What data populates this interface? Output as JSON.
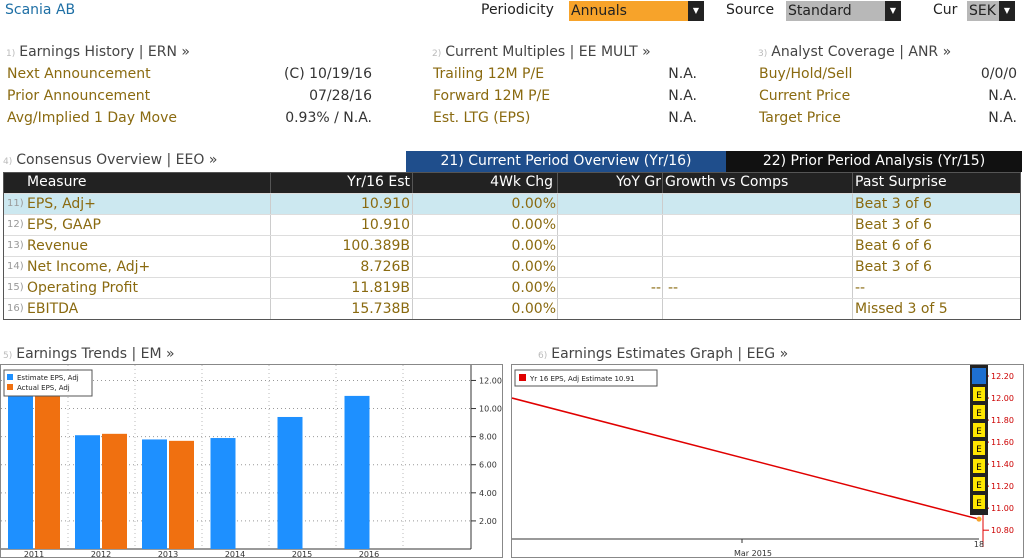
{
  "header": {
    "company": "Scania AB",
    "periodicity_label": "Periodicity",
    "periodicity_value": "Annuals",
    "source_label": "Source",
    "source_value": "Standard",
    "cur_label": "Cur",
    "cur_value": "SEK"
  },
  "sections": {
    "earnings_history": {
      "num": "1)",
      "title": "Earnings History | ERN »",
      "rows": [
        {
          "label": "Next Announcement",
          "value": "(C)  10/19/16"
        },
        {
          "label": "Prior Announcement",
          "value": "07/28/16"
        },
        {
          "label": "Avg/Implied 1 Day Move",
          "value": "0.93% / N.A."
        }
      ]
    },
    "current_multiples": {
      "num": "2)",
      "title": "Current Multiples | EE MULT »",
      "rows": [
        {
          "label": "Trailing 12M P/E",
          "value": "N.A."
        },
        {
          "label": "Forward 12M P/E",
          "value": "N.A."
        },
        {
          "label": "Est. LTG (EPS)",
          "value": "N.A."
        }
      ]
    },
    "analyst_coverage": {
      "num": "3)",
      "title": "Analyst Coverage | ANR »",
      "rows": [
        {
          "label": "Buy/Hold/Sell",
          "value": "0/0/0"
        },
        {
          "label": "Current Price",
          "value": "N.A."
        },
        {
          "label": "Target Price",
          "value": "N.A."
        }
      ]
    }
  },
  "consensus": {
    "num": "4)",
    "title": "Consensus Overview | EEO »",
    "tab_current": "21) Current Period Overview (Yr/16)",
    "tab_prior": "22) Prior Period Analysis (Yr/15)",
    "columns": [
      "Measure",
      "Yr/16 Est",
      "4Wk Chg",
      "YoY Gr",
      "Growth vs Comps",
      "Past Surprise"
    ],
    "rows": [
      {
        "num": "11)",
        "measure": "EPS, Adj+",
        "est": "10.910",
        "chg": "0.00%",
        "yoy": "",
        "comps": "",
        "surprise": "Beat 3 of 6"
      },
      {
        "num": "12)",
        "measure": "EPS, GAAP",
        "est": "10.910",
        "chg": "0.00%",
        "yoy": "",
        "comps": "",
        "surprise": "Beat 3 of 6"
      },
      {
        "num": "13)",
        "measure": "Revenue",
        "est": "100.389B",
        "chg": "0.00%",
        "yoy": "",
        "comps": "",
        "surprise": "Beat 6 of 6"
      },
      {
        "num": "14)",
        "measure": "Net Income, Adj+",
        "est": "8.726B",
        "chg": "0.00%",
        "yoy": "",
        "comps": "",
        "surprise": "Beat 3 of 6"
      },
      {
        "num": "15)",
        "measure": "Operating Profit",
        "est": "11.819B",
        "chg": "0.00%",
        "yoy": "--",
        "comps": "--",
        "surprise": "--"
      },
      {
        "num": "16)",
        "measure": "EBITDA",
        "est": "15.738B",
        "chg": "0.00%",
        "yoy": "",
        "comps": "",
        "surprise": "Missed 3 of 5"
      }
    ]
  },
  "trends": {
    "num": "5)",
    "title": "Earnings Trends | EM »"
  },
  "graph": {
    "num": "6)",
    "title": "Earnings Estimates Graph | EEG »"
  },
  "colors": {
    "estimate": "#1e90ff",
    "actual": "#f07010",
    "line": "#e00000",
    "tab_active": "#1f4e8c",
    "tab_inactive": "#111111",
    "label_gold": "#8a6a10"
  },
  "chart_data": [
    {
      "type": "bar",
      "categories": [
        "2011",
        "2012",
        "2013",
        "2014",
        "2015",
        "2016"
      ],
      "series": [
        {
          "name": "Estimate EPS, Adj",
          "values": [
            11.8,
            8.1,
            7.8,
            7.9,
            9.4,
            10.9
          ]
        },
        {
          "name": "Actual EPS, Adj",
          "values": [
            11.8,
            8.2,
            7.7,
            null,
            null,
            null
          ]
        }
      ],
      "yticks": [
        "2.00",
        "4.00",
        "6.00",
        "8.00",
        "10.00",
        "12.00"
      ],
      "ylim": [
        0,
        13.1
      ],
      "legend": "top-left"
    },
    {
      "type": "line",
      "series": [
        {
          "name": "Yr 16 EPS, Adj Estimate 10.91",
          "start": 12.0,
          "end": 10.9
        }
      ],
      "xlabel_tick": "Mar 2015",
      "right_tick": "18",
      "yticks": [
        "10.80",
        "11.00",
        "11.20",
        "11.40",
        "11.60",
        "11.80",
        "12.00",
        "12.20"
      ],
      "ylim": [
        10.72,
        12.3
      ],
      "markers": [
        "E",
        "E",
        "E",
        "E",
        "E",
        "E",
        "E"
      ]
    }
  ]
}
